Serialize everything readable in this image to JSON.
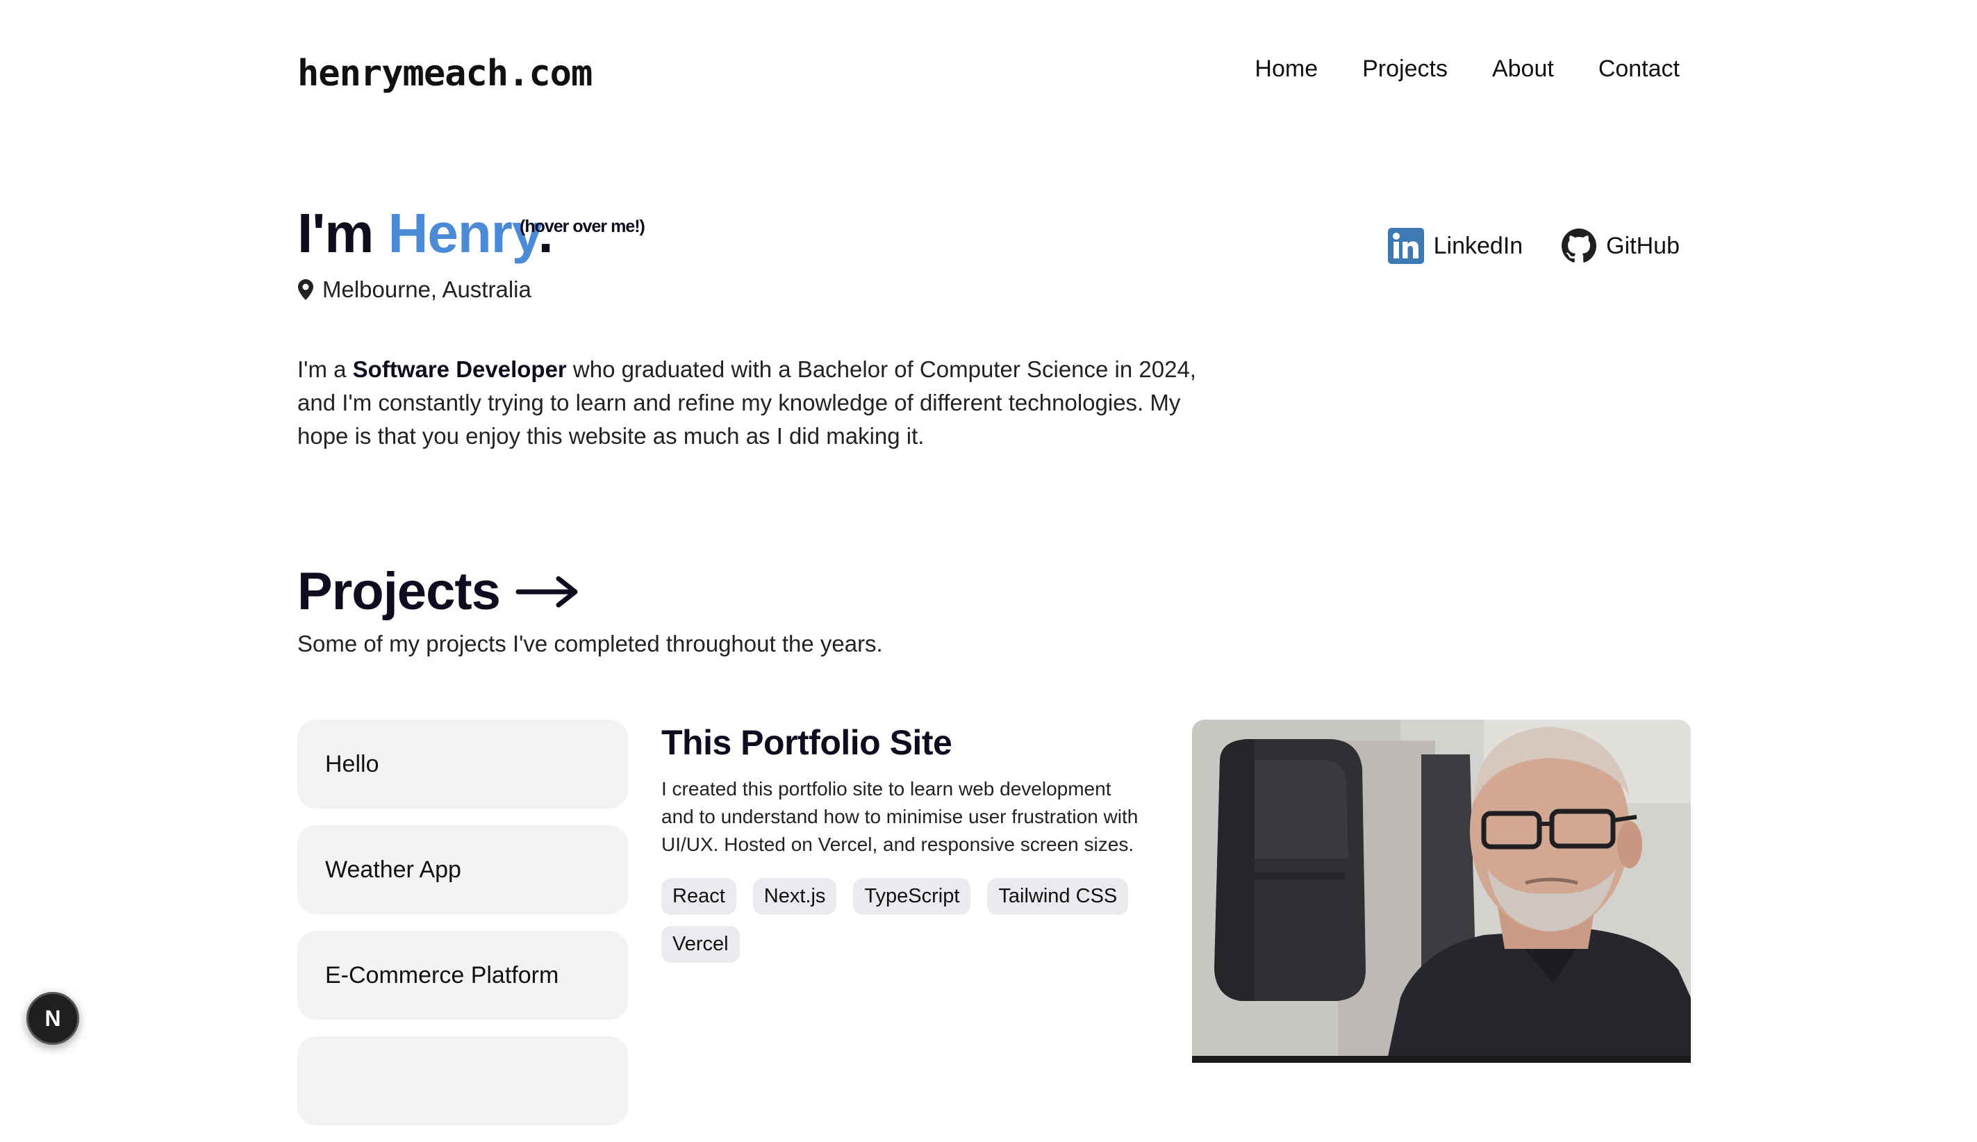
{
  "header": {
    "logo": "henrymeach.com",
    "nav": [
      "Home",
      "Projects",
      "About",
      "Contact"
    ]
  },
  "intro": {
    "heading_prefix": "I'm ",
    "name": "Henry",
    "heading_suffix": ".",
    "hover_note": "(hover over me!)",
    "location": "Melbourne, Australia",
    "bio_prefix": "I'm a ",
    "bio_bold": "Software Developer",
    "bio_rest": " who graduated with a Bachelor of Computer Science in 2024, and I'm constantly trying to learn and refine my knowledge of different technologies. My hope is that you enjoy this website as much as I did making it."
  },
  "socials": {
    "linkedin": "LinkedIn",
    "github": "GitHub"
  },
  "projects": {
    "heading": "Projects",
    "subtitle": "Some of my projects I've completed throughout the years.",
    "list": [
      "Hello",
      "Weather App",
      "E-Commerce Platform",
      ""
    ],
    "selected": {
      "title": "This Portfolio Site",
      "description": "I created this portfolio site to learn web development and to understand how to minimise user frustration with UI/UX. Hosted on Vercel, and responsive screen sizes.",
      "tags": [
        "React",
        "Next.js",
        "TypeScript",
        "Tailwind CSS",
        "Vercel"
      ]
    }
  },
  "badge": {
    "label": "N"
  },
  "colors": {
    "accent": "#4a8ad6",
    "heading": "#0d0d1f",
    "card_bg": "#f2f3f5",
    "tag_bg": "#eaebee"
  }
}
